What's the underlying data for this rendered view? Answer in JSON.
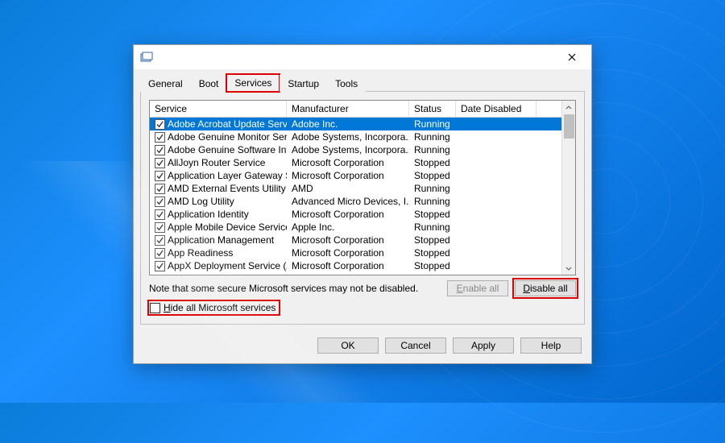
{
  "tabs": [
    "General",
    "Boot",
    "Services",
    "Startup",
    "Tools"
  ],
  "activeTab": "Services",
  "columns": [
    "Service",
    "Manufacturer",
    "Status",
    "Date Disabled"
  ],
  "rows": [
    {
      "svc": "Adobe Acrobat Update Service",
      "mfr": "Adobe Inc.",
      "st": "Running",
      "dd": "",
      "sel": true
    },
    {
      "svc": "Adobe Genuine Monitor Service",
      "mfr": "Adobe Systems, Incorpora...",
      "st": "Running",
      "dd": ""
    },
    {
      "svc": "Adobe Genuine Software Integri...",
      "mfr": "Adobe Systems, Incorpora...",
      "st": "Running",
      "dd": ""
    },
    {
      "svc": "AllJoyn Router Service",
      "mfr": "Microsoft Corporation",
      "st": "Stopped",
      "dd": ""
    },
    {
      "svc": "Application Layer Gateway Service",
      "mfr": "Microsoft Corporation",
      "st": "Stopped",
      "dd": ""
    },
    {
      "svc": "AMD External Events Utility",
      "mfr": "AMD",
      "st": "Running",
      "dd": ""
    },
    {
      "svc": "AMD Log Utility",
      "mfr": "Advanced Micro Devices, I...",
      "st": "Running",
      "dd": ""
    },
    {
      "svc": "Application Identity",
      "mfr": "Microsoft Corporation",
      "st": "Stopped",
      "dd": ""
    },
    {
      "svc": "Apple Mobile Device Service",
      "mfr": "Apple Inc.",
      "st": "Running",
      "dd": ""
    },
    {
      "svc": "Application Management",
      "mfr": "Microsoft Corporation",
      "st": "Stopped",
      "dd": ""
    },
    {
      "svc": "App Readiness",
      "mfr": "Microsoft Corporation",
      "st": "Stopped",
      "dd": ""
    },
    {
      "svc": "AppX Deployment Service (AppX...",
      "mfr": "Microsoft Corporation",
      "st": "Stopped",
      "dd": ""
    }
  ],
  "note": "Note that some secure Microsoft services may not be disabled.",
  "enableAll": "Enable all",
  "disableAll": "Disable all",
  "hideMs": "Hide all Microsoft services",
  "ok": "OK",
  "cancel": "Cancel",
  "apply": "Apply",
  "help": "Help"
}
